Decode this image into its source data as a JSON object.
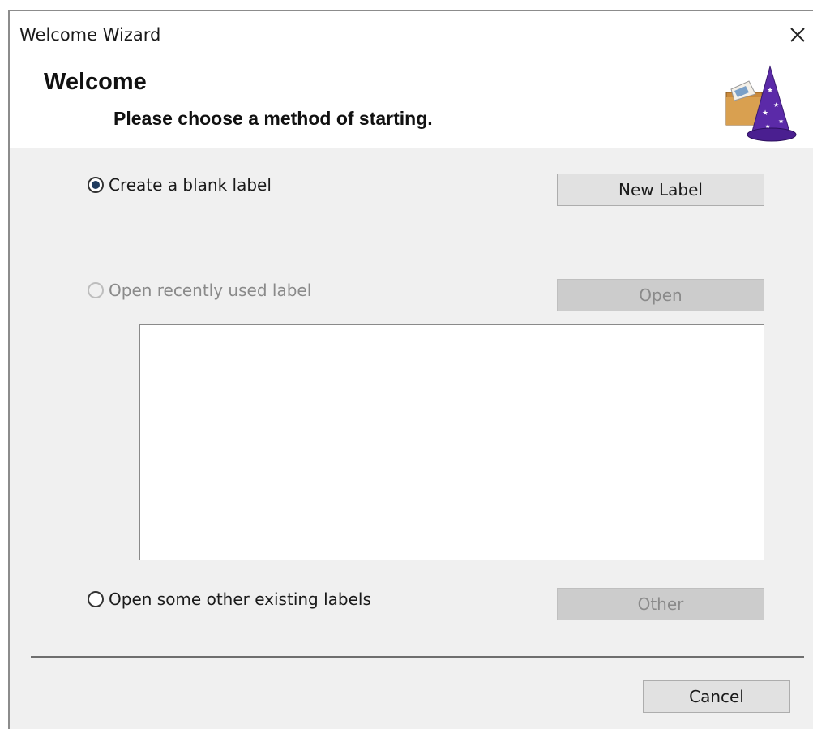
{
  "window": {
    "title": "Welcome Wizard",
    "close_glyph": "✕"
  },
  "header": {
    "title": "Welcome",
    "subtitle": "Please choose a method of starting.",
    "icon": "wizard-hat-icon"
  },
  "options": [
    {
      "label": "Create a blank label",
      "selected": true,
      "enabled": true,
      "button": "New Label",
      "button_enabled": true
    },
    {
      "label": "Open recently used label",
      "selected": false,
      "enabled": false,
      "button": "Open",
      "button_enabled": false
    },
    {
      "label": "Open some other existing labels",
      "selected": false,
      "enabled": true,
      "button": "Other",
      "button_enabled": false
    }
  ],
  "recent_list": {
    "items": []
  },
  "footer": {
    "cancel_label": "Cancel"
  },
  "colors": {
    "dialog_bg": "#f0f0f0",
    "header_bg": "#ffffff",
    "radio_dot": "#1f3b5e",
    "disabled_text": "#8a8a8a"
  }
}
